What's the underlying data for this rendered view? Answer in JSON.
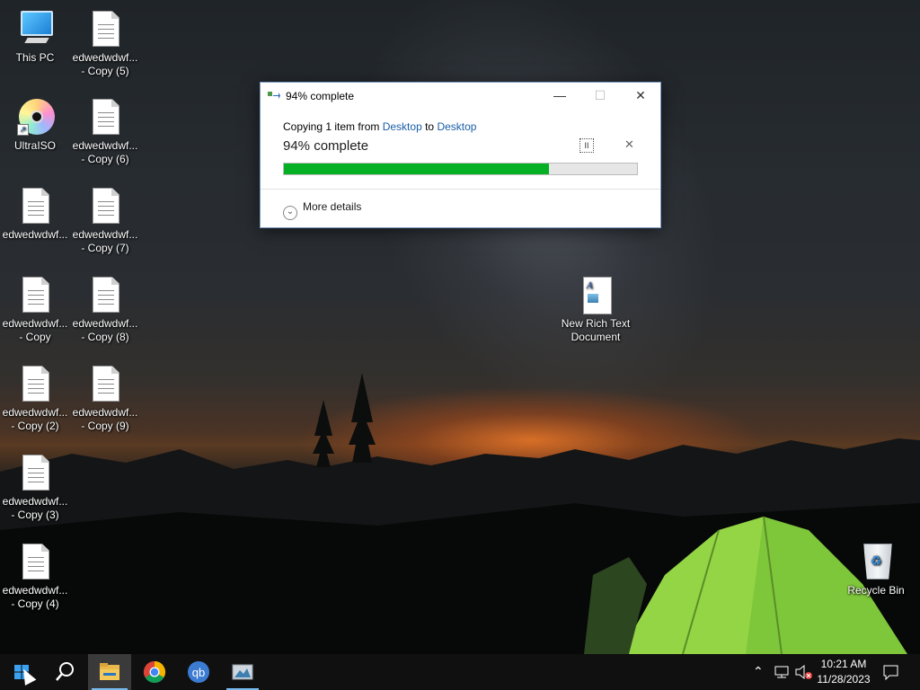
{
  "desktop": {
    "icons": [
      {
        "label": "This PC",
        "icon": "this-pc-icon"
      },
      {
        "label": "edwedwdwf... - Copy (5)",
        "icon": "text-file-icon"
      },
      {
        "label": "UltraISO",
        "icon": "disc-icon"
      },
      {
        "label": "edwedwdwf... - Copy (6)",
        "icon": "text-file-icon"
      },
      {
        "label": "edwedwdwf...",
        "icon": "text-file-icon"
      },
      {
        "label": "edwedwdwf... - Copy (7)",
        "icon": "text-file-icon"
      },
      {
        "label": "edwedwdwf... - Copy",
        "icon": "text-file-icon"
      },
      {
        "label": "edwedwdwf... - Copy (8)",
        "icon": "text-file-icon"
      },
      {
        "label": "edwedwdwf... - Copy (2)",
        "icon": "text-file-icon"
      },
      {
        "label": "edwedwdwf... - Copy (9)",
        "icon": "text-file-icon"
      },
      {
        "label": "edwedwdwf... - Copy (3)",
        "icon": "text-file-icon"
      },
      {
        "label": "edwedwdwf... - Copy (4)",
        "icon": "text-file-icon"
      },
      {
        "label": "New Rich Text Document",
        "icon": "rich-text-document-icon"
      },
      {
        "label": "Recycle Bin",
        "icon": "recycle-bin-icon"
      }
    ]
  },
  "dialog": {
    "title": "94% complete",
    "copying_prefix": "Copying 1 item from ",
    "source": "Desktop",
    "to_word": " to ",
    "destination": "Desktop",
    "status": "94% complete",
    "progress_fraction": 0.75,
    "pause_glyph": "II",
    "cancel_glyph": "✕",
    "more_details": "More details",
    "colors": {
      "progress": "#06b025",
      "link": "#1a5da8"
    }
  },
  "window_controls": {
    "minimize": "—",
    "maximize": "☐",
    "close": "✕"
  },
  "taskbar": {
    "apps": [
      "start-button",
      "search-button",
      "file-explorer",
      "chrome",
      "qbittorrent",
      "copy-dialog-app"
    ],
    "qb_text": "qb",
    "clock_time": "10:21 AM",
    "clock_date": "11/28/2023"
  }
}
